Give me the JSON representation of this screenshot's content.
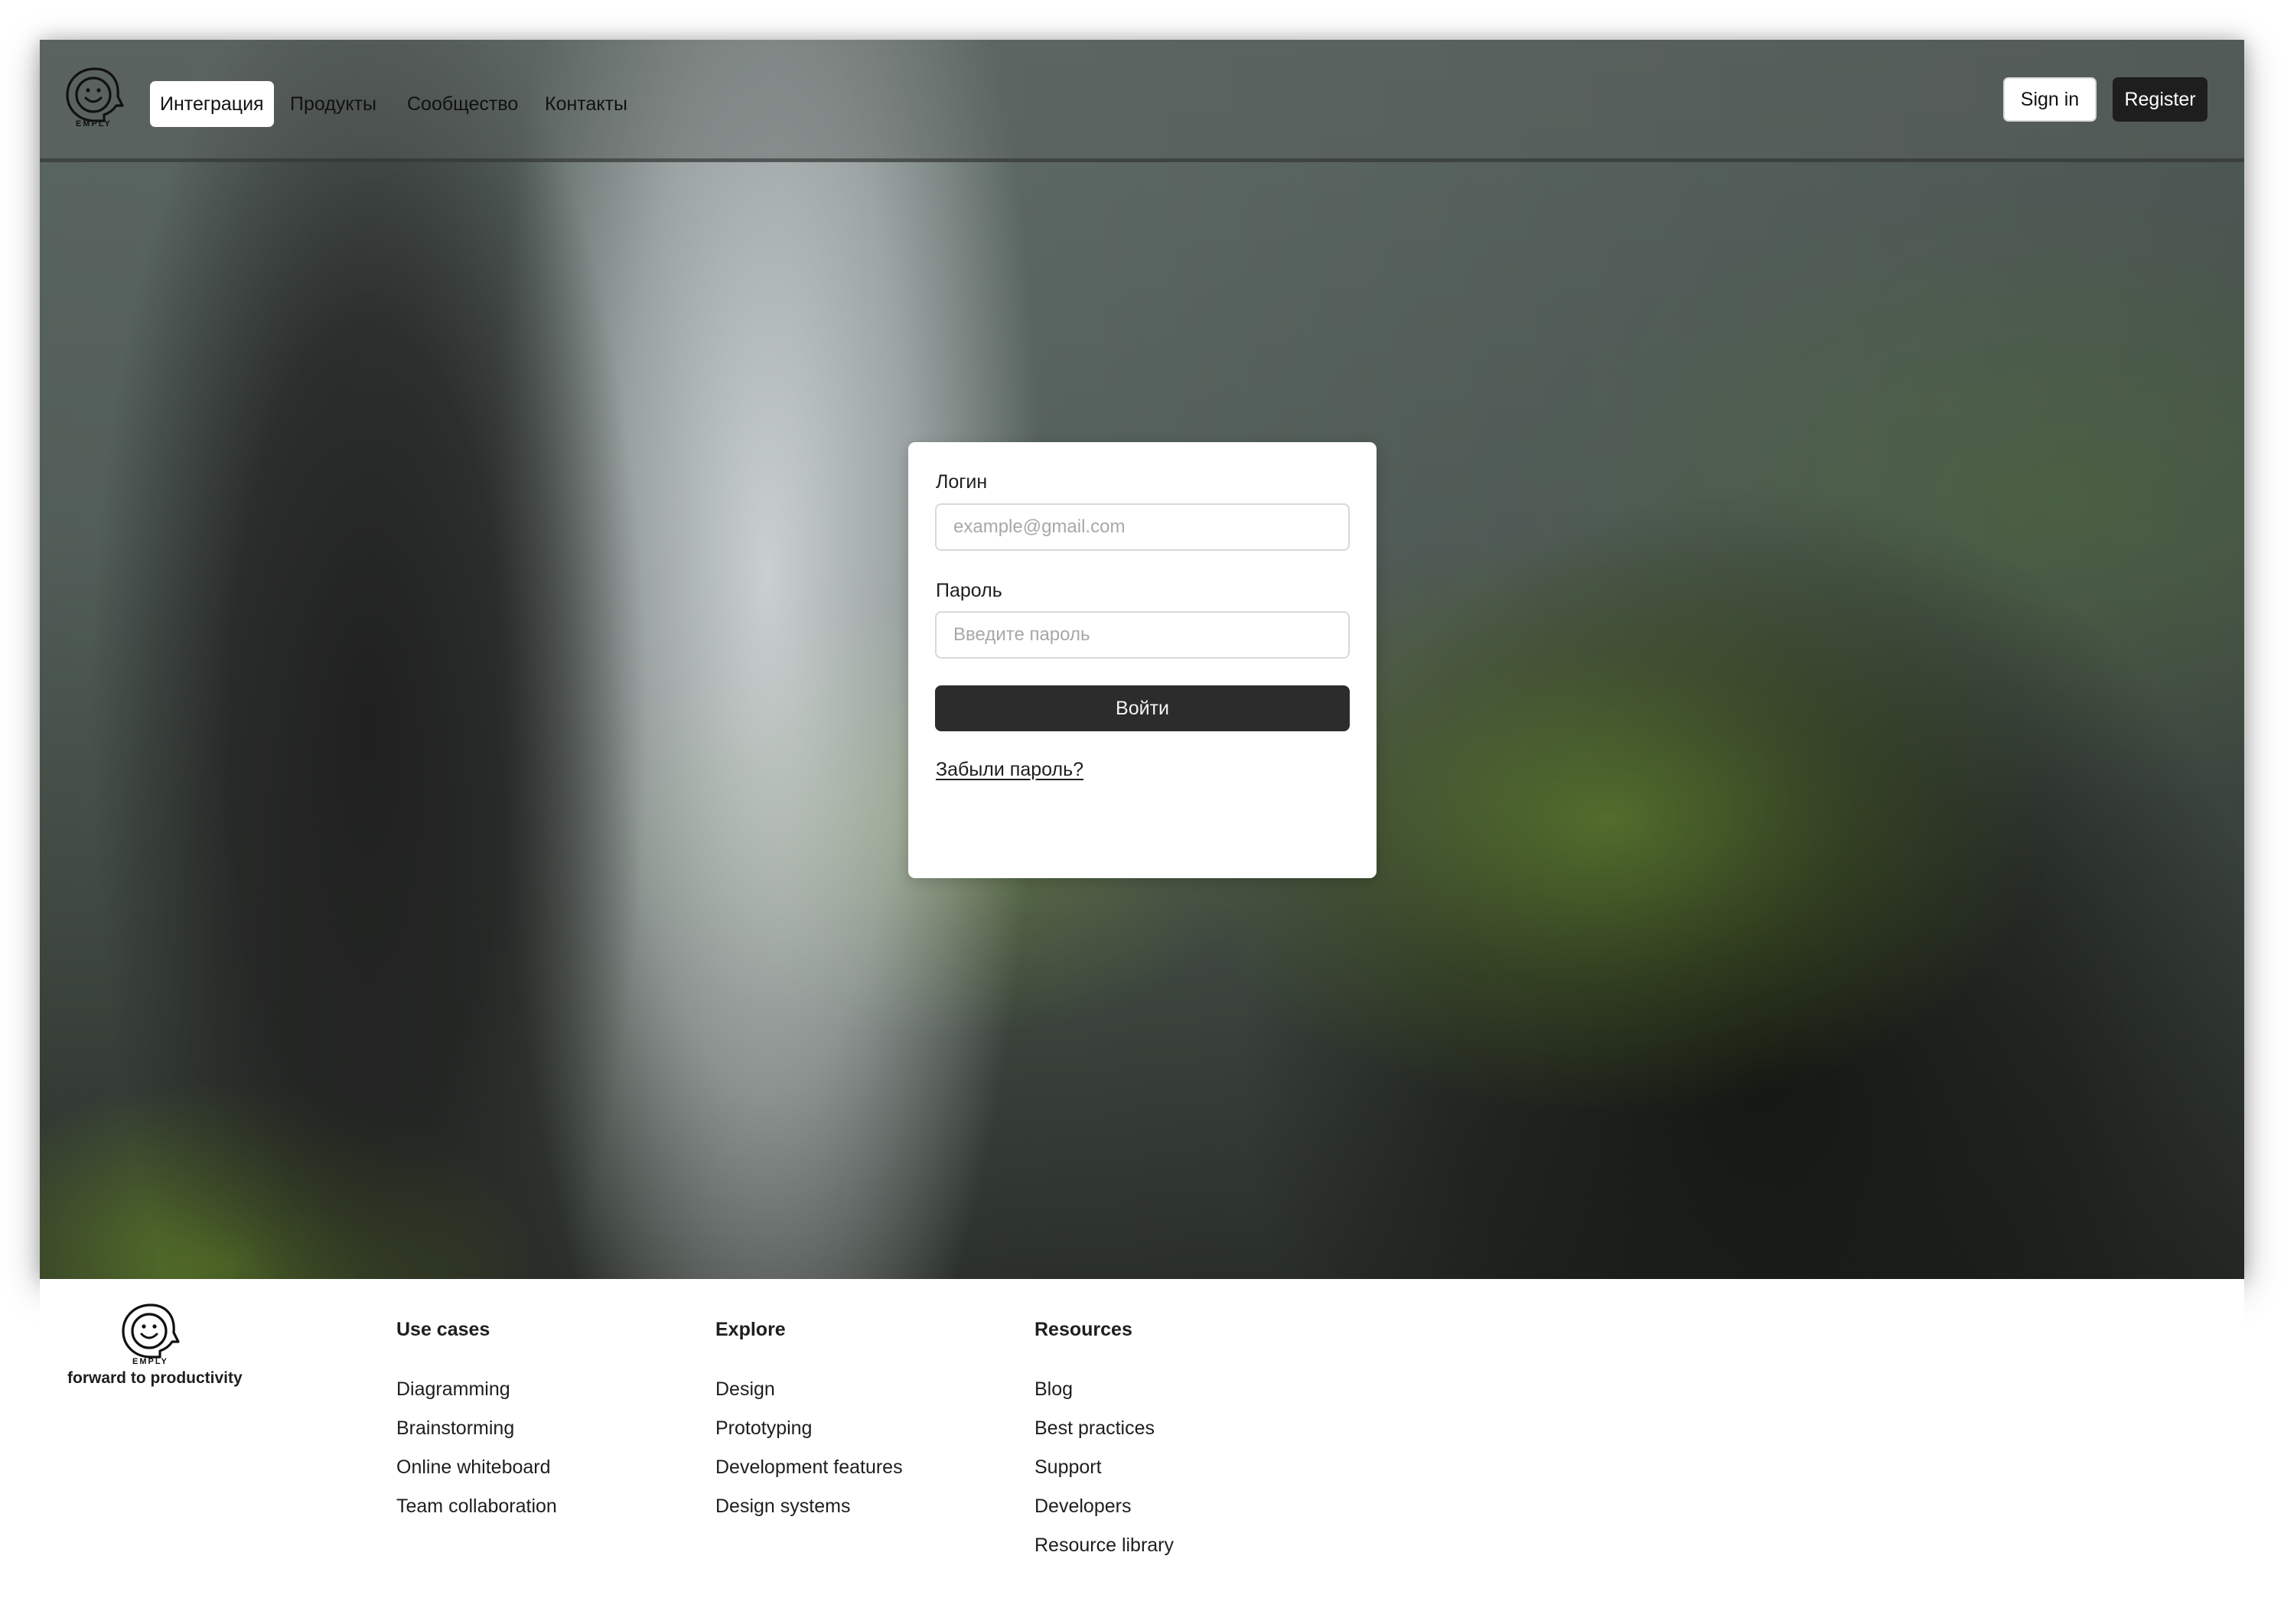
{
  "header": {
    "logo_text": "EMPLY",
    "nav_items": [
      {
        "label": "Интеграция",
        "active": true
      },
      {
        "label": "Продукты",
        "active": false
      },
      {
        "label": "Сообщество",
        "active": false
      },
      {
        "label": "Контакты",
        "active": false
      }
    ],
    "sign_in_label": "Sign in",
    "register_label": "Register"
  },
  "login_form": {
    "login_label": "Логин",
    "login_placeholder": "example@gmail.com",
    "login_value": "",
    "password_label": "Пароль",
    "password_placeholder": "Введите пароль",
    "password_value": "",
    "submit_label": "Войти",
    "forgot_label": "Забыли пароль?"
  },
  "footer": {
    "logo_text": "EMPLY",
    "tagline": "forward to productivity",
    "columns": [
      {
        "heading": "Use cases",
        "links": [
          "Diagramming",
          "Brainstorming",
          "Online whiteboard",
          "Team collaboration"
        ]
      },
      {
        "heading": "Explore",
        "links": [
          "Design",
          "Prototyping",
          "Development features",
          "Design systems"
        ]
      },
      {
        "heading": "Resources",
        "links": [
          "Blog",
          "Best practices",
          "Support",
          "Developers",
          "Resource library"
        ]
      }
    ]
  },
  "icons": {
    "logo": "smiley-head-icon"
  },
  "colors": {
    "primary_button": "#2c2c2c",
    "register_button": "#1e1e1e",
    "text": "#1e1e1e",
    "input_border": "#d9d9d9",
    "placeholder": "#a8a8a8"
  }
}
